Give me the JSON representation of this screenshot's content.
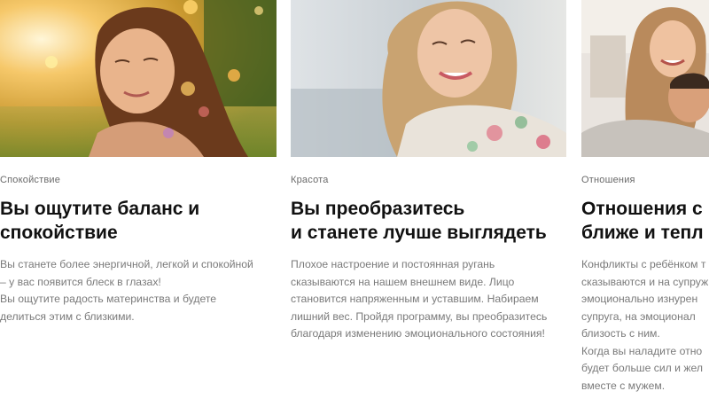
{
  "cards": [
    {
      "category": "Спокойствие",
      "title": "Вы ощутите баланс и\nспокойствие",
      "description": "Вы станете более энергичной, легкой и спокойной\n– у вас появится блеск в глазах!\nВы ощутите радость материнства и будете\nделиться этим с близкими.",
      "image": "woman-sunlight-photo"
    },
    {
      "category": "Красота",
      "title": "Вы преобразитесь\nи станете лучше выглядеть",
      "description": "Плохое настроение и постоянная ругань\nсказываются на нашем внешнем виде. Лицо\nстановится напряженным и уставшим. Набираем\nлишний вес. Пройдя программу, вы преобразитесь\nблагодаря изменению эмоционального состояния!",
      "image": "smiling-woman-photo"
    },
    {
      "category": "Отношения",
      "title": "Отношения с\nближе и тепл",
      "description": "Конфликты с ребёнком т\nсказываются и на супруж\nэмоционально изнурен\nсупруга, на эмоционал\nблизость с ним.\nКогда вы наладите отно\nбудет больше сил и жел\nвместе с мужем.",
      "image": "couple-photo"
    }
  ]
}
